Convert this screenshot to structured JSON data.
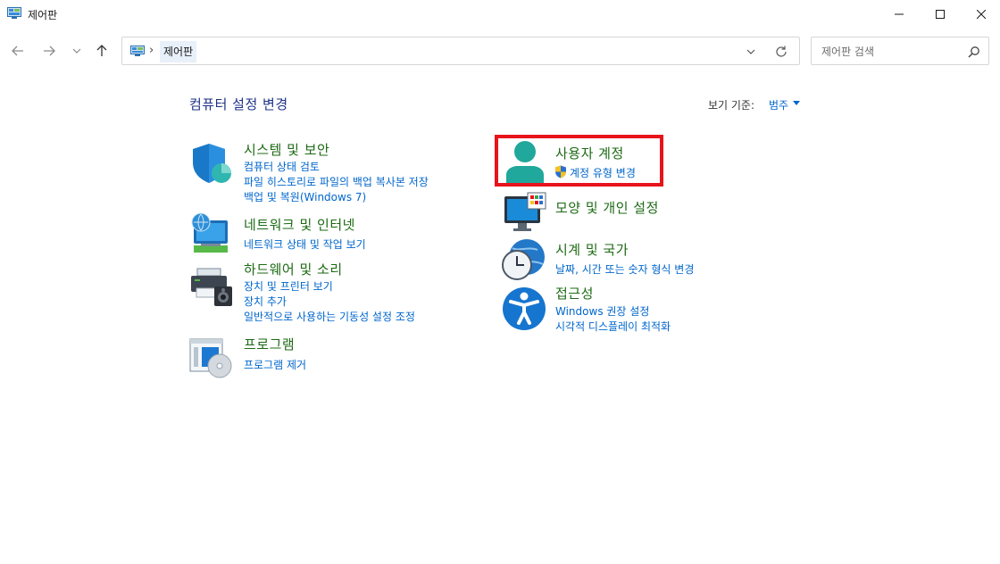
{
  "window": {
    "title": "제어판"
  },
  "address_bar": {
    "breadcrumb": "제어판",
    "separator": "›"
  },
  "search": {
    "placeholder": "제어판 검색"
  },
  "content": {
    "heading": "컴퓨터 설정 변경",
    "view_by_label": "보기 기준:",
    "view_by_value": "범주"
  },
  "categories": [
    {
      "title": "시스템 및 보안",
      "icon": "shield-icon",
      "links": [
        "컴퓨터 상태 검토",
        "파일 히스토리로 파일의 백업 복사본 저장",
        "백업 및 복원(Windows 7)"
      ]
    },
    {
      "title": "네트워크 및 인터넷",
      "icon": "network-icon",
      "links": [
        "네트워크 상태 및 작업 보기"
      ]
    },
    {
      "title": "하드웨어 및 소리",
      "icon": "printer-speaker-icon",
      "links": [
        "장치 및 프린터 보기",
        "장치 추가",
        "일반적으로 사용하는 기동성 설정 조정"
      ]
    },
    {
      "title": "프로그램",
      "icon": "programs-icon",
      "links": [
        "프로그램 제거"
      ]
    },
    {
      "title": "사용자 계정",
      "icon": "user-icon",
      "links": [
        "계정 유형 변경"
      ]
    },
    {
      "title": "모양 및 개인 설정",
      "icon": "monitor-icon",
      "links": []
    },
    {
      "title": "시계 및 국가",
      "icon": "clock-globe-icon",
      "links": [
        "날짜, 시간 또는 숫자 형식 변경"
      ]
    },
    {
      "title": "접근성",
      "icon": "accessibility-icon",
      "links": [
        "Windows 권장 설정",
        "시각적 디스플레이 최적화"
      ]
    }
  ],
  "colors": {
    "category_title": "#1d6a14",
    "link": "#0066cc",
    "heading": "#1e3287",
    "highlight": "#e8141b"
  }
}
